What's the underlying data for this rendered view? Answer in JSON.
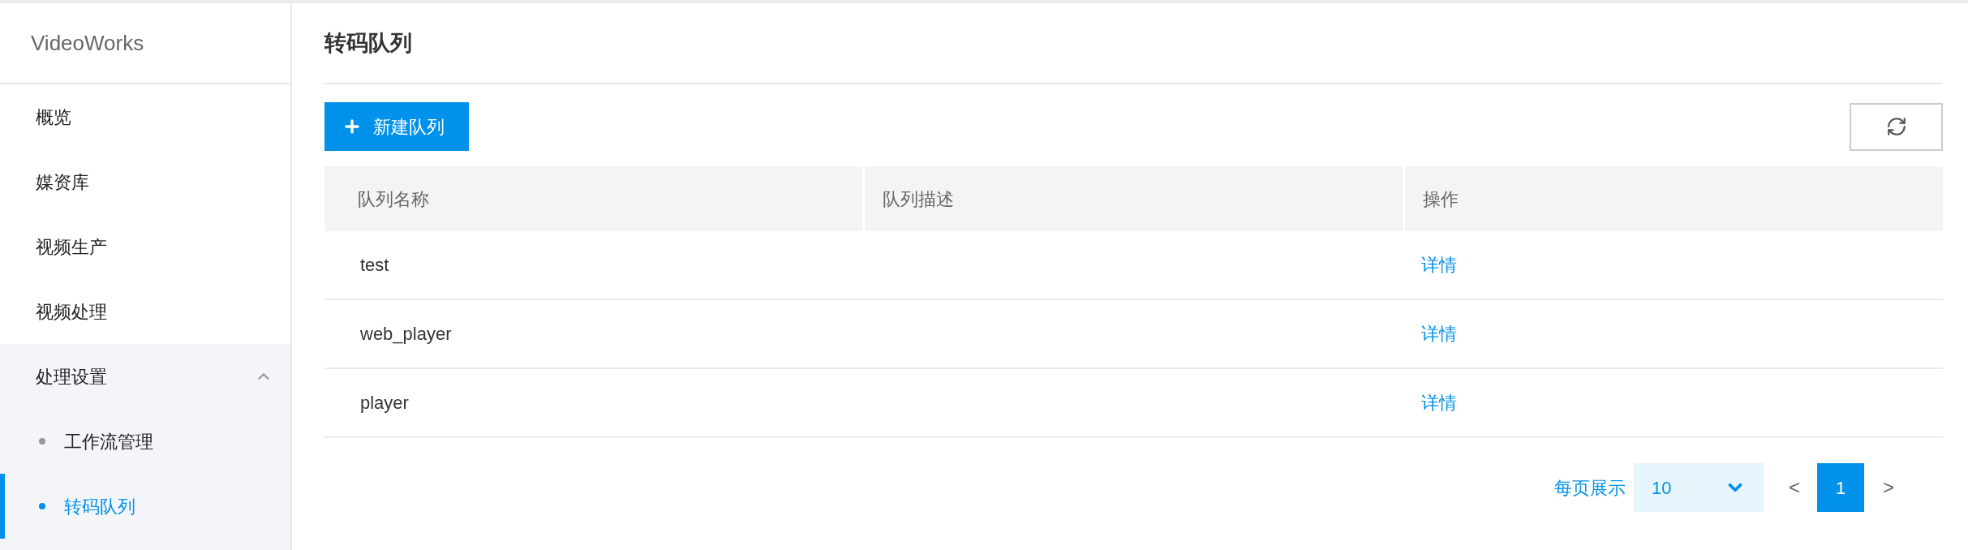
{
  "sidebar": {
    "logo": "VideoWorks",
    "items": [
      {
        "label": "概览",
        "selected": false
      },
      {
        "label": "媒资库",
        "selected": false
      },
      {
        "label": "视频生产",
        "selected": false
      },
      {
        "label": "视频处理",
        "selected": false
      },
      {
        "label": "处理设置",
        "selected": false,
        "expanded": true,
        "children": [
          {
            "label": "工作流管理",
            "selected": false
          },
          {
            "label": "转码队列",
            "selected": true
          }
        ]
      }
    ]
  },
  "page": {
    "title": "转码队列"
  },
  "toolbar": {
    "new_button": "新建队列"
  },
  "table": {
    "columns": [
      "队列名称",
      "队列描述",
      "操作"
    ],
    "rows": [
      {
        "name": "test",
        "action": "详情"
      },
      {
        "name": "web_player",
        "action": "详情"
      },
      {
        "name": "player",
        "action": "详情"
      }
    ]
  },
  "pagination": {
    "page_size_label": "每页展示",
    "page_size": "10",
    "prev": "<",
    "pages": [
      {
        "label": "1",
        "selected": true
      }
    ],
    "next": ">"
  }
}
